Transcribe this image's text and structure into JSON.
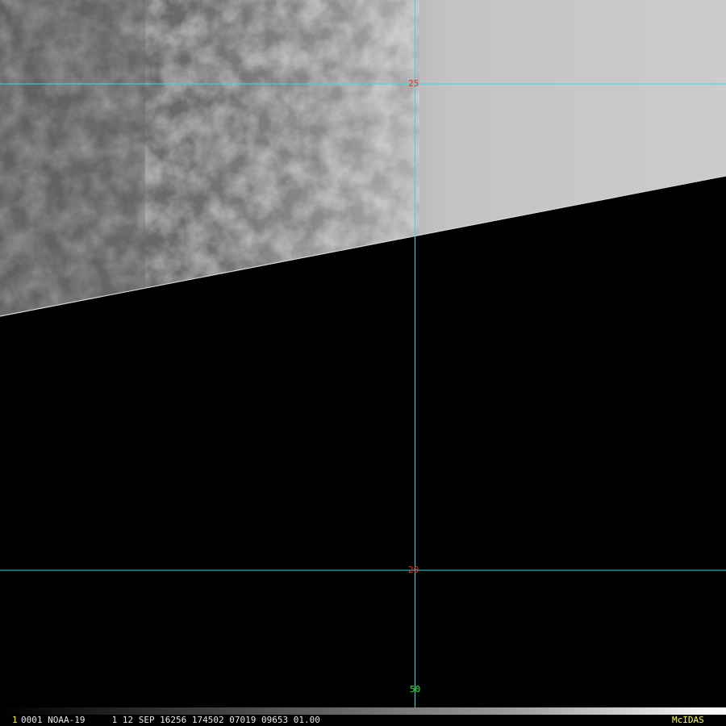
{
  "satellite_image": {
    "grid_color": "#33dddd",
    "latitude_labels": [
      {
        "value": "25",
        "color": "#ff2a2a"
      },
      {
        "value": "20",
        "color": "#ff2a2a"
      }
    ],
    "longitude_label": {
      "value": "50",
      "color": "#33ee33"
    }
  },
  "status_bar": {
    "frame_number": "1",
    "frame_number_color": "#ffff33",
    "info_text": "0001 NOAA-19     1 12 SEP 16256 174502 07019 09653 01.00",
    "info_color": "#e8e8e8",
    "logo_text": "McIDAS",
    "logo_color": "#ffff33"
  }
}
